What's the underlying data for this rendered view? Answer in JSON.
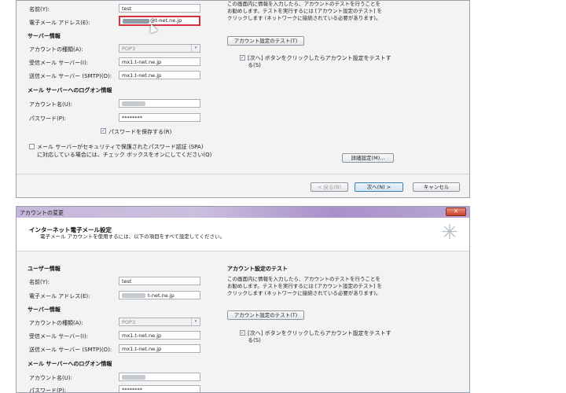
{
  "window1": {
    "fields": {
      "name_label": "名前(Y):",
      "name_value": "test",
      "email_label": "電子メール アドレス(E):",
      "email_value_suffix": "@t-net.ne.jp"
    },
    "server_info": {
      "heading": "サーバー情報",
      "account_type_label": "アカウントの種類(A):",
      "account_type_value": "POP3",
      "incoming_label": "受信メール サーバー(I):",
      "incoming_value": "mx1.t-net.ne.jp",
      "outgoing_label": "送信メール サーバー (SMTP)(O):",
      "outgoing_value": "mx1.t-net.ne.jp"
    },
    "logon": {
      "heading": "メール サーバーへのログオン情報",
      "account_label": "アカウント名(U):",
      "password_label": "パスワード(P):",
      "password_value": "********",
      "save_password_label": "パスワードを保存する(R)",
      "spa_line1": "メール サーバーがセキュリティで保護されたパスワード認証 (SPA)",
      "spa_line2": "に対応している場合には、チェック ボックスをオンにしてください(Q)"
    },
    "test": {
      "desc_line1": "この画面内に情報を入力したら、アカウントのテストを行うことを",
      "desc_line2": "お勧めします。テストを実行するには [アカウント設定のテスト] を",
      "desc_line3": "クリックします (ネットワークに接続されている必要があります)。",
      "test_button": "アカウント設定のテスト(T)",
      "next_check_line1": "[次へ] ボタンをクリックしたらアカウント設定をテストす",
      "next_check_line2": "る(S)"
    },
    "more_settings_button": "詳細設定(M)...",
    "nav": {
      "back": "< 戻る(B)",
      "next": "次へ(N) >",
      "cancel": "キャンセル"
    }
  },
  "window2": {
    "title": "アカウントの変更",
    "close_glyph": "✕",
    "header_title": "インターネット電子メール設定",
    "header_sub": "電子メール アカウントを使用するには、以下の項目をすべて設定してください。",
    "user_info": {
      "heading": "ユーザー情報",
      "name_label": "名前(Y):",
      "name_value": "test",
      "email_label": "電子メール アドレス(E):",
      "email_value_suffix": "t-net.ne.jp"
    },
    "server_info": {
      "heading": "サーバー情報",
      "account_type_label": "アカウントの種類(A):",
      "account_type_value": "POP3",
      "incoming_label": "受信メール サーバー(I):",
      "incoming_value": "mx1.t-net.ne.jp",
      "outgoing_label": "送信メール サーバー (SMTP)(O):",
      "outgoing_value": "mx1.t-net.ne.jp"
    },
    "logon": {
      "heading": "メール サーバーへのログオン情報",
      "account_label": "アカウント名(U):",
      "password_label": "パスワード(P):",
      "password_value": "********"
    },
    "test": {
      "heading": "アカウント設定のテスト",
      "desc_line1": "この画面内に情報を入力したら、アカウントのテストを行うことを",
      "desc_line2": "お勧めします。テストを実行するには [アカウント設定のテスト] を",
      "desc_line3": "クリックします (ネットワークに接続されている必要があります)。",
      "test_button": "アカウント設定のテスト(T)",
      "next_check_line1": "[次へ] ボタンをクリックしたらアカウント設定をテストす",
      "next_check_line2": "る(S)"
    }
  },
  "glyphs": {
    "check": "✓",
    "dropdown": "▾",
    "wizard": "✳"
  },
  "colors": {
    "highlight_border": "#d2313a",
    "titlebar": "#b8a7d4",
    "close_button": "#c7412a",
    "primary_button_border": "#3c7fb1"
  }
}
